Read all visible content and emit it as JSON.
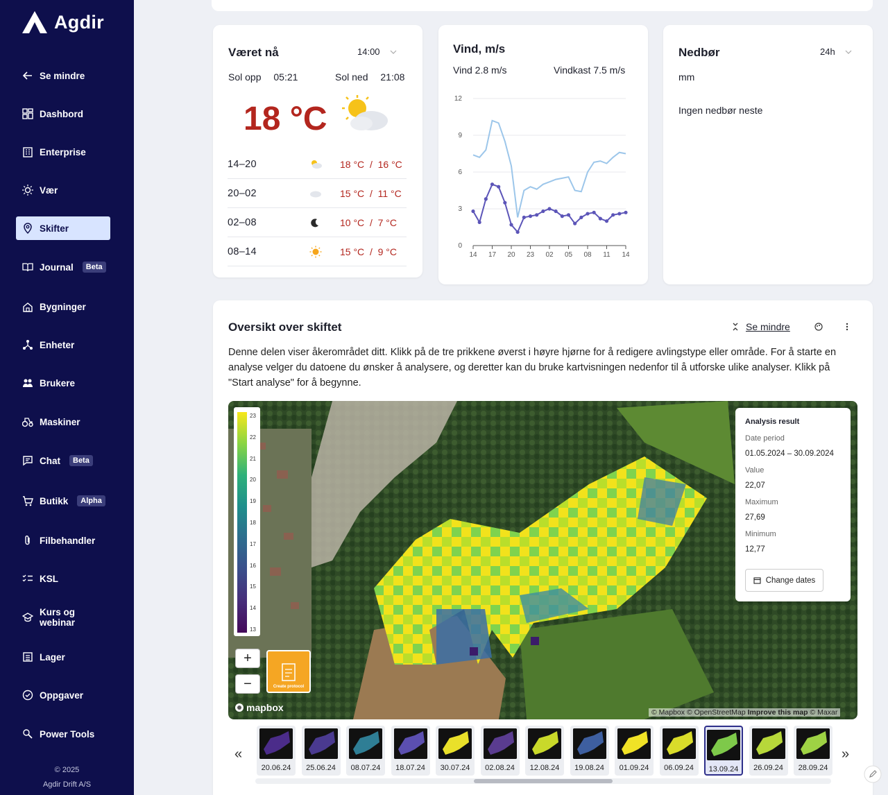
{
  "app": {
    "name": "Agdir",
    "copyright": "© 2025",
    "company": "Agdir Drift A/S"
  },
  "sidebar": {
    "collapse_label": "Se mindre",
    "items": [
      {
        "label": "Dashbord",
        "icon": "dashboard-icon"
      },
      {
        "label": "Enterprise",
        "icon": "building-icon"
      },
      {
        "label": "Vær",
        "icon": "sun-icon"
      },
      {
        "label": "Skifter",
        "icon": "location-pin-icon",
        "active": true
      },
      {
        "label": "Journal",
        "icon": "book-icon",
        "badge": "Beta"
      },
      {
        "label": "Bygninger",
        "icon": "home-icon"
      },
      {
        "label": "Enheter",
        "icon": "network-icon"
      },
      {
        "label": "Brukere",
        "icon": "users-icon"
      },
      {
        "label": "Maskiner",
        "icon": "tractor-icon"
      },
      {
        "label": "Chat",
        "icon": "chat-icon",
        "badge": "Beta"
      },
      {
        "label": "Butikk",
        "icon": "cart-icon",
        "badge": "Alpha"
      },
      {
        "label": "Filbehandler",
        "icon": "paperclip-icon"
      },
      {
        "label": "KSL",
        "icon": "checklist-icon"
      },
      {
        "label": "Kurs og webinar",
        "icon": "graduation-cap-icon"
      },
      {
        "label": "Lager",
        "icon": "warehouse-icon"
      },
      {
        "label": "Oppgaver",
        "icon": "task-icon"
      },
      {
        "label": "Power Tools",
        "icon": "tools-icon"
      }
    ]
  },
  "weather_now": {
    "title": "Været nå",
    "time": "14:00",
    "sunrise_label": "Sol opp",
    "sunrise": "05:21",
    "sunset_label": "Sol ned",
    "sunset": "21:08",
    "temperature": "18 °C",
    "forecast": [
      {
        "period": "14–20",
        "icon": "partly-cloudy-icon",
        "temps": "18 °C  /  16 °C"
      },
      {
        "period": "20–02",
        "icon": "cloud-icon",
        "temps": "15 °C  /  11 °C"
      },
      {
        "period": "02–08",
        "icon": "moon-icon",
        "temps": "10 °C  /  7 °C"
      },
      {
        "period": "08–14",
        "icon": "sun-icon",
        "temps": "15 °C  /  9 °C"
      }
    ]
  },
  "wind": {
    "title": "Vind, m/s",
    "wind_label": "Vind 2.8 m/s",
    "gust_label": "Vindkast 7.5 m/s"
  },
  "chart_data": {
    "type": "line",
    "title": "Vind, m/s",
    "x": [
      "14",
      "15",
      "16",
      "17",
      "18",
      "19",
      "20",
      "21",
      "22",
      "23",
      "00",
      "01",
      "02",
      "03",
      "04",
      "05",
      "06",
      "07",
      "08",
      "09",
      "10",
      "11",
      "12",
      "13",
      "14"
    ],
    "xticks": [
      "14",
      "17",
      "20",
      "23",
      "02",
      "05",
      "08",
      "11",
      "14"
    ],
    "ylim": [
      0,
      12
    ],
    "yticks": [
      0,
      3,
      6,
      9,
      12
    ],
    "grid": true,
    "series": [
      {
        "name": "Vindkast",
        "color": "#9cc6ea",
        "values": [
          7.4,
          7.2,
          7.8,
          10.2,
          10.0,
          8.5,
          6.5,
          2.3,
          4.5,
          4.8,
          4.6,
          5.0,
          5.2,
          5.4,
          5.5,
          5.6,
          4.5,
          4.4,
          6.0,
          6.8,
          6.9,
          6.7,
          7.2,
          7.6,
          7.5
        ]
      },
      {
        "name": "Vind",
        "color": "#5c55b8",
        "values": [
          2.8,
          1.9,
          3.8,
          5.0,
          4.8,
          3.5,
          1.7,
          1.1,
          2.3,
          2.4,
          2.5,
          2.8,
          3.0,
          2.8,
          2.4,
          2.5,
          1.8,
          2.3,
          2.6,
          2.7,
          2.2,
          2.0,
          2.5,
          2.6,
          2.7
        ]
      }
    ]
  },
  "precipitation": {
    "title": "Nedbør",
    "range": "24h",
    "unit": "mm",
    "message": "Ingen nedbør neste"
  },
  "overview": {
    "title": "Oversikt over skiftet",
    "collapse_label": "Se mindre",
    "description": "Denne delen viser åkerområdet ditt. Klikk på de tre prikkene øverst i høyre hjørne for å redigere avlingstype eller område. For å starte en analyse velger du datoene du ønsker å analysere, og deretter kan du bruke kartvisningen nedenfor til å utforske ulike analyser. Klikk på \"Start analyse\" for å begynne."
  },
  "map": {
    "legend_ticks": [
      "23",
      "22",
      "21",
      "20",
      "19",
      "18",
      "17",
      "16",
      "15",
      "14",
      "13"
    ],
    "attribution": "© Mapbox © OpenStreetMap",
    "improve_label": "Improve this map",
    "maxar": "© Maxar",
    "mapbox_logo": "mapbox",
    "create_label": "Create protocol",
    "zoom_in": "+",
    "zoom_out": "−"
  },
  "analysis": {
    "title": "Analysis result",
    "date_label": "Date period",
    "date_value": "01.05.2024 – 30.09.2024",
    "value_label": "Value",
    "value": "22,07",
    "max_label": "Maximum",
    "max": "27,69",
    "min_label": "Minimum",
    "min": "12,77",
    "change_label": "Change dates"
  },
  "timeline": {
    "prev": "«",
    "next": "»",
    "dates": [
      "20.06.24",
      "25.06.24",
      "08.07.24",
      "18.07.24",
      "30.07.24",
      "02.08.24",
      "12.08.24",
      "19.08.24",
      "01.09.24",
      "06.09.24",
      "13.09.24",
      "26.09.24",
      "28.09.24"
    ],
    "selected_index": 10
  }
}
